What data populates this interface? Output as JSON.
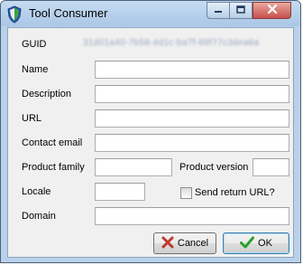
{
  "window": {
    "title": "Tool Consumer"
  },
  "form": {
    "guid_label": "GUID",
    "guid_value": "31d01a40-7b58-4d1c-ba7f-88f77c3dea6a",
    "name_label": "Name",
    "name_value": "",
    "description_label": "Description",
    "description_value": "",
    "url_label": "URL",
    "url_value": "",
    "contact_email_label": "Contact email",
    "contact_email_value": "",
    "product_family_label": "Product family",
    "product_family_value": "",
    "product_version_label": "Product version",
    "product_version_value": "",
    "locale_label": "Locale",
    "locale_value": "",
    "send_return_url_label": "Send return URL?",
    "send_return_url_checked": false,
    "domain_label": "Domain",
    "domain_value": ""
  },
  "buttons": {
    "cancel_label": "Cancel",
    "ok_label": "OK"
  },
  "colors": {
    "cancel_icon": "#c0392b",
    "ok_icon": "#2aa02a"
  }
}
